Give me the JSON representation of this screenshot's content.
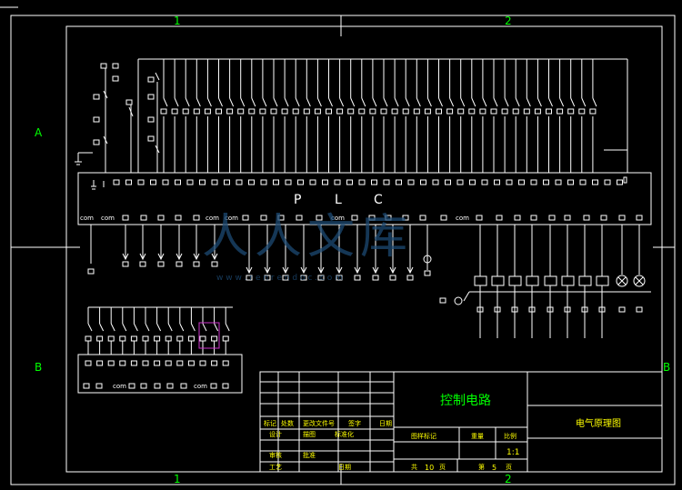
{
  "frame": {
    "zone_top": [
      "1",
      "2"
    ],
    "zone_bottom": [
      "1",
      "2"
    ],
    "zone_left": [
      "A",
      "B"
    ],
    "zone_right": [
      "B"
    ]
  },
  "plc": {
    "label_letters": [
      "P",
      "L",
      "C"
    ],
    "com_label": "com",
    "lower_com_label": "com"
  },
  "title_block": {
    "drawing_name": "控制电路",
    "sheet_name": "电气原理图",
    "rev_headers": [
      "标记",
      "处数",
      "更改文件号",
      "签字",
      "日期"
    ],
    "row_design": [
      "设计",
      "描图",
      "标准化"
    ],
    "row_check": [
      "审核",
      "批准"
    ],
    "row_process": [
      "工艺",
      "日期"
    ],
    "stage_headers": [
      "图样标记",
      "重量",
      "比例"
    ],
    "scale_value": "1:1",
    "sheets_total_label": "共",
    "sheets_total": "10",
    "sheets_unit": "页",
    "sheet_no_label": "第",
    "sheet_no": "5",
    "sheet_no_unit": "页"
  },
  "watermark": {
    "text": "人人文库",
    "url": "w w w . r e n r e n d o c . c o m"
  },
  "colors": {
    "background": "#000000",
    "line": "#ffffff",
    "text_green": "#00ff00",
    "text_yellow": "#ffff00",
    "highlight": "#cc33cc",
    "watermark": "#1d4a73"
  }
}
